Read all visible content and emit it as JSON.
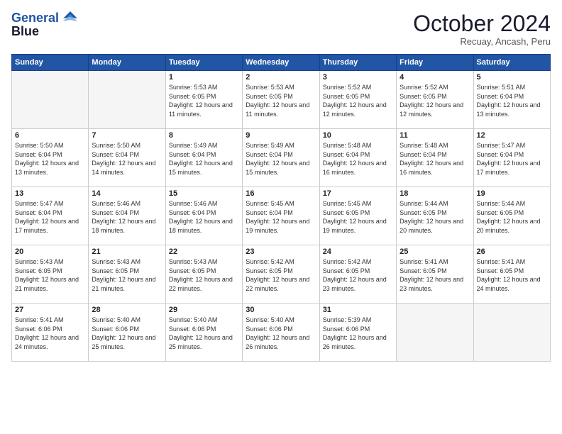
{
  "header": {
    "logo_line1": "General",
    "logo_line2": "Blue",
    "month": "October 2024",
    "location": "Recuay, Ancash, Peru"
  },
  "weekdays": [
    "Sunday",
    "Monday",
    "Tuesday",
    "Wednesday",
    "Thursday",
    "Friday",
    "Saturday"
  ],
  "weeks": [
    [
      {
        "day": "",
        "info": ""
      },
      {
        "day": "",
        "info": ""
      },
      {
        "day": "1",
        "info": "Sunrise: 5:53 AM\nSunset: 6:05 PM\nDaylight: 12 hours and 11 minutes."
      },
      {
        "day": "2",
        "info": "Sunrise: 5:53 AM\nSunset: 6:05 PM\nDaylight: 12 hours and 11 minutes."
      },
      {
        "day": "3",
        "info": "Sunrise: 5:52 AM\nSunset: 6:05 PM\nDaylight: 12 hours and 12 minutes."
      },
      {
        "day": "4",
        "info": "Sunrise: 5:52 AM\nSunset: 6:05 PM\nDaylight: 12 hours and 12 minutes."
      },
      {
        "day": "5",
        "info": "Sunrise: 5:51 AM\nSunset: 6:04 PM\nDaylight: 12 hours and 13 minutes."
      }
    ],
    [
      {
        "day": "6",
        "info": "Sunrise: 5:50 AM\nSunset: 6:04 PM\nDaylight: 12 hours and 13 minutes."
      },
      {
        "day": "7",
        "info": "Sunrise: 5:50 AM\nSunset: 6:04 PM\nDaylight: 12 hours and 14 minutes."
      },
      {
        "day": "8",
        "info": "Sunrise: 5:49 AM\nSunset: 6:04 PM\nDaylight: 12 hours and 15 minutes."
      },
      {
        "day": "9",
        "info": "Sunrise: 5:49 AM\nSunset: 6:04 PM\nDaylight: 12 hours and 15 minutes."
      },
      {
        "day": "10",
        "info": "Sunrise: 5:48 AM\nSunset: 6:04 PM\nDaylight: 12 hours and 16 minutes."
      },
      {
        "day": "11",
        "info": "Sunrise: 5:48 AM\nSunset: 6:04 PM\nDaylight: 12 hours and 16 minutes."
      },
      {
        "day": "12",
        "info": "Sunrise: 5:47 AM\nSunset: 6:04 PM\nDaylight: 12 hours and 17 minutes."
      }
    ],
    [
      {
        "day": "13",
        "info": "Sunrise: 5:47 AM\nSunset: 6:04 PM\nDaylight: 12 hours and 17 minutes."
      },
      {
        "day": "14",
        "info": "Sunrise: 5:46 AM\nSunset: 6:04 PM\nDaylight: 12 hours and 18 minutes."
      },
      {
        "day": "15",
        "info": "Sunrise: 5:46 AM\nSunset: 6:04 PM\nDaylight: 12 hours and 18 minutes."
      },
      {
        "day": "16",
        "info": "Sunrise: 5:45 AM\nSunset: 6:04 PM\nDaylight: 12 hours and 19 minutes."
      },
      {
        "day": "17",
        "info": "Sunrise: 5:45 AM\nSunset: 6:05 PM\nDaylight: 12 hours and 19 minutes."
      },
      {
        "day": "18",
        "info": "Sunrise: 5:44 AM\nSunset: 6:05 PM\nDaylight: 12 hours and 20 minutes."
      },
      {
        "day": "19",
        "info": "Sunrise: 5:44 AM\nSunset: 6:05 PM\nDaylight: 12 hours and 20 minutes."
      }
    ],
    [
      {
        "day": "20",
        "info": "Sunrise: 5:43 AM\nSunset: 6:05 PM\nDaylight: 12 hours and 21 minutes."
      },
      {
        "day": "21",
        "info": "Sunrise: 5:43 AM\nSunset: 6:05 PM\nDaylight: 12 hours and 21 minutes."
      },
      {
        "day": "22",
        "info": "Sunrise: 5:43 AM\nSunset: 6:05 PM\nDaylight: 12 hours and 22 minutes."
      },
      {
        "day": "23",
        "info": "Sunrise: 5:42 AM\nSunset: 6:05 PM\nDaylight: 12 hours and 22 minutes."
      },
      {
        "day": "24",
        "info": "Sunrise: 5:42 AM\nSunset: 6:05 PM\nDaylight: 12 hours and 23 minutes."
      },
      {
        "day": "25",
        "info": "Sunrise: 5:41 AM\nSunset: 6:05 PM\nDaylight: 12 hours and 23 minutes."
      },
      {
        "day": "26",
        "info": "Sunrise: 5:41 AM\nSunset: 6:05 PM\nDaylight: 12 hours and 24 minutes."
      }
    ],
    [
      {
        "day": "27",
        "info": "Sunrise: 5:41 AM\nSunset: 6:06 PM\nDaylight: 12 hours and 24 minutes."
      },
      {
        "day": "28",
        "info": "Sunrise: 5:40 AM\nSunset: 6:06 PM\nDaylight: 12 hours and 25 minutes."
      },
      {
        "day": "29",
        "info": "Sunrise: 5:40 AM\nSunset: 6:06 PM\nDaylight: 12 hours and 25 minutes."
      },
      {
        "day": "30",
        "info": "Sunrise: 5:40 AM\nSunset: 6:06 PM\nDaylight: 12 hours and 26 minutes."
      },
      {
        "day": "31",
        "info": "Sunrise: 5:39 AM\nSunset: 6:06 PM\nDaylight: 12 hours and 26 minutes."
      },
      {
        "day": "",
        "info": ""
      },
      {
        "day": "",
        "info": ""
      }
    ]
  ]
}
